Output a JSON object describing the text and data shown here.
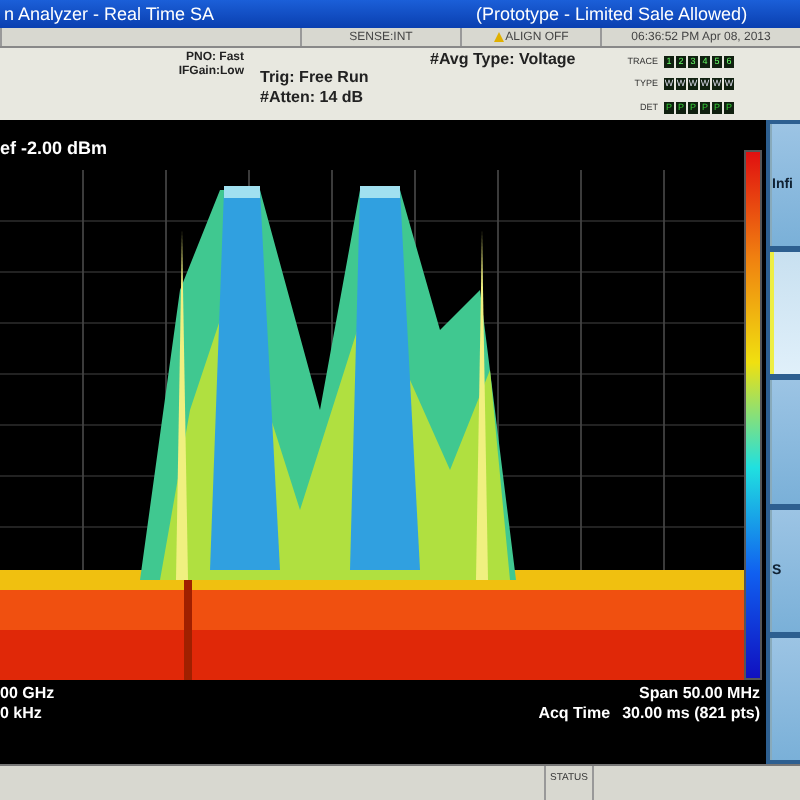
{
  "window": {
    "title": "n Analyzer - Real Time SA",
    "notice": "(Prototype - Limited Sale Allowed)"
  },
  "status_row": [
    {
      "text": "SENSE:INT",
      "kind": "plain"
    },
    {
      "text": "ALIGN OFF",
      "kind": "warning"
    },
    {
      "text": "06:36:52 PM Apr 08, 2013",
      "kind": "plain"
    }
  ],
  "settings": {
    "pno": "PNO: Fast",
    "ifgain": "IFGain:Low",
    "trig": "Trig: Free Run",
    "atten": "#Atten: 14 dB",
    "avg": "#Avg Type: Voltage"
  },
  "trace_panel": {
    "rows": [
      {
        "label": "TRACE",
        "cells": [
          "1",
          "2",
          "3",
          "4",
          "5",
          "6"
        ]
      },
      {
        "label": "TYPE",
        "cells": [
          "W",
          "W",
          "W",
          "W",
          "W",
          "W"
        ]
      },
      {
        "label": "DET",
        "cells": [
          "P",
          "P",
          "P",
          "P",
          "P",
          "P"
        ]
      }
    ]
  },
  "ref_level": "ef -2.00 dBm",
  "footer": {
    "left": [
      "00 GHz",
      "0 kHz"
    ],
    "span": "Span 50.00 MHz",
    "acq_label": "Acq Time",
    "acq_value": "30.00 ms (821 pts)"
  },
  "softkeys": [
    {
      "label": "Infi",
      "selected": false
    },
    {
      "selected": true
    },
    {
      "selected": false
    },
    {
      "label": "S",
      "selected": false
    },
    {
      "selected": false
    }
  ],
  "status_bar": {
    "label": "STATUS"
  }
}
